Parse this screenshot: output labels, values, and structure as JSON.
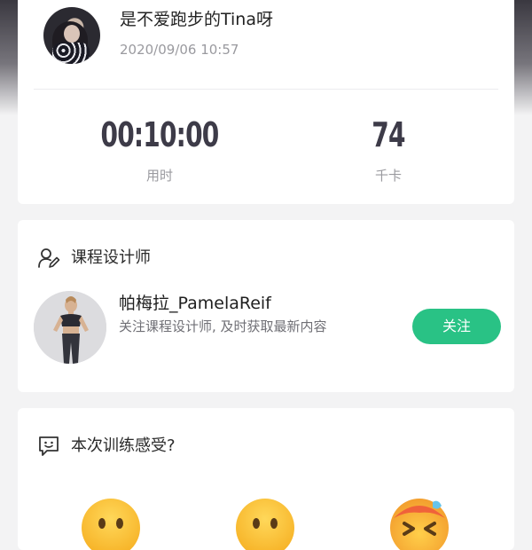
{
  "summary": {
    "username": "是不爱跑步的Tina呀",
    "datetime": "2020/09/06 10:57",
    "stats": [
      {
        "value": "00:10:00",
        "label": "用时"
      },
      {
        "value": "74",
        "label": "千卡"
      }
    ]
  },
  "designer_section": {
    "title": "课程设计师",
    "name": "帕梅拉_PamelaReif",
    "subtitle": "关注课程设计师, 及时获取最新内容",
    "follow_label": "关注"
  },
  "feedback": {
    "title": "本次训练感受?"
  },
  "colors": {
    "accent": "#29c285",
    "stat_text": "#3d3b48",
    "muted": "#9a9a9f"
  },
  "icons": [
    "user-edit-icon",
    "chat-smile-icon",
    "emoji-happy-icon",
    "emoji-neutral-icon",
    "emoji-hot-icon"
  ]
}
